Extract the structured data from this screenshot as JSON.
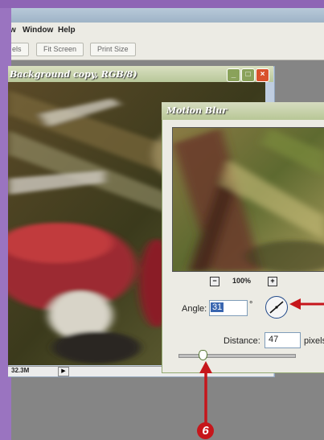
{
  "menu": {
    "partial_view": "w",
    "window": "Window",
    "help": "Help"
  },
  "toolbar": {
    "actual_pixels_partial": "els",
    "fit_screen": "Fit Screen",
    "print_size": "Print Size"
  },
  "document": {
    "title": "Background copy, RGB/8)",
    "status_size": "32.3M",
    "window_buttons": [
      "minimize-icon",
      "maximize-icon",
      "close-icon"
    ]
  },
  "dialog": {
    "title": "Motion Blur",
    "zoom_out": "−",
    "zoom_level": "100%",
    "zoom_in": "+",
    "angle_label": "Angle:",
    "angle_value": "31",
    "angle_unit": "°",
    "distance_label": "Distance:",
    "distance_value": "47",
    "distance_unit": "pixels",
    "slider_level_fraction": 0.2
  },
  "annotation": {
    "step_number": "6",
    "arrow_color": "#c6161b"
  },
  "colors": {
    "purple_band": "#8e64b5",
    "title_bar_green": "#b8c79a",
    "close_button_red": "#d9522c"
  }
}
